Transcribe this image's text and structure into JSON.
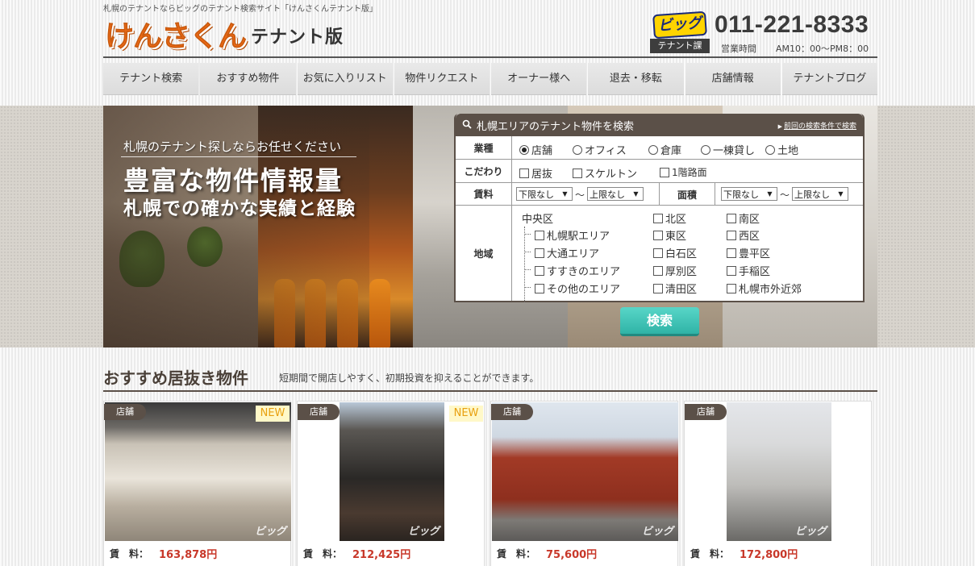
{
  "header": {
    "tagline": "札幌のテナントならビッグのテナント検索サイト「けんさくんテナント版」",
    "logo_main": "けんさくん",
    "logo_sub": "テナント版",
    "brand_badge": "ビッグ",
    "badge_label": "テナント課",
    "phone": "011-221-8333",
    "hours_label": "営業時間",
    "hours": "AM10：00～PM8：00"
  },
  "nav": {
    "items": [
      {
        "label": "テナント検索"
      },
      {
        "label": "おすすめ物件"
      },
      {
        "label": "お気に入りリスト"
      },
      {
        "label": "物件リクエスト"
      },
      {
        "label": "オーナー様へ"
      },
      {
        "label": "退去・移転"
      },
      {
        "label": "店舗情報"
      },
      {
        "label": "テナントブログ"
      }
    ]
  },
  "hero": {
    "small": "札幌のテナント探しならお任せください",
    "big": "豊富な物件情報量",
    "mid": "札幌での確かな実績と経験"
  },
  "search": {
    "title": "札幌エリアのテナント物件を検索",
    "prev_link": "前回の検索条件で検索",
    "labels": {
      "type": "業種",
      "feature": "こだわり",
      "rent": "賃料",
      "area_size": "面積",
      "region": "地域"
    },
    "types": [
      {
        "label": "店舗",
        "checked": true
      },
      {
        "label": "オフィス",
        "checked": false
      },
      {
        "label": "倉庫",
        "checked": false
      },
      {
        "label": "一棟貸し",
        "checked": false
      },
      {
        "label": "土地",
        "checked": false
      }
    ],
    "features": [
      "居抜",
      "スケルトン",
      "1階路面"
    ],
    "rent_min": "下限なし",
    "rent_max": "上限なし",
    "size_min": "下限なし",
    "size_max": "上限なし",
    "tilde": "～",
    "central": "中央区",
    "central_sub": [
      "札幌駅エリア",
      "大通エリア",
      "すすきのエリア",
      "その他のエリア"
    ],
    "wards_col1": [
      "北区",
      "東区",
      "白石区",
      "厚別区",
      "清田区"
    ],
    "wards_col2": [
      "南区",
      "西区",
      "豊平区",
      "手稲区",
      "札幌市外近郊"
    ],
    "button": "検索"
  },
  "featured": {
    "title": "おすすめ居抜き物件",
    "subtitle": "短期間で開店しやすく、初期投資を抑えることができます。",
    "price_label": "賃　料：",
    "watermark": "ビッグ",
    "cards": [
      {
        "tag": "店舗",
        "new": "NEW",
        "price": "163,878円"
      },
      {
        "tag": "店舗",
        "new": "NEW",
        "price": "212,425円"
      },
      {
        "tag": "店舗",
        "new": "",
        "price": "75,600円"
      },
      {
        "tag": "店舗",
        "new": "",
        "price": "172,800円"
      }
    ]
  },
  "colors": {
    "logo": "#ee6a16",
    "panel": "#5b5048",
    "button": "#3cc3b5",
    "price": "#c8382a"
  }
}
